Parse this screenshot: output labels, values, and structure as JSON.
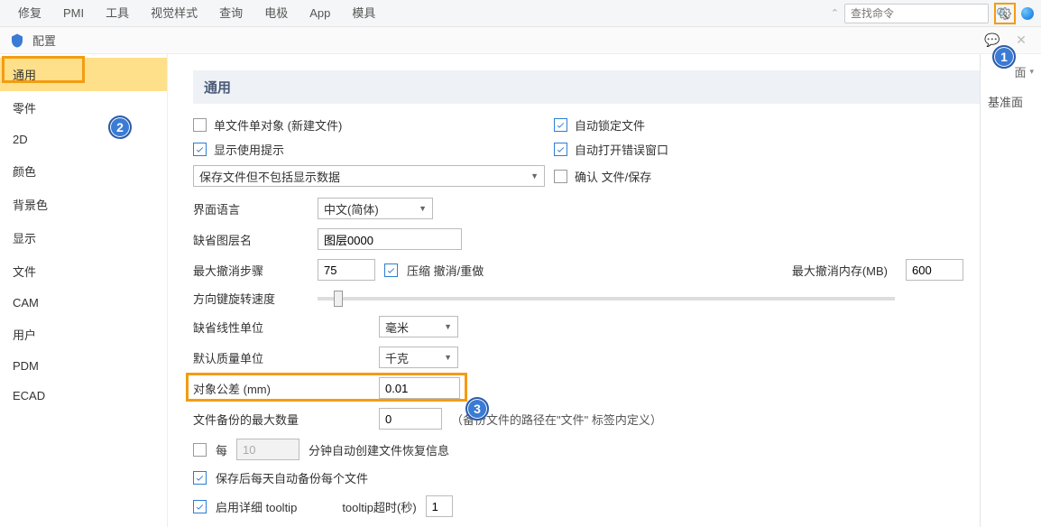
{
  "callouts": {
    "c1": "1",
    "c2": "2",
    "c3": "3"
  },
  "menubar": {
    "items": [
      "修复",
      "PMI",
      "工具",
      "视觉样式",
      "查询",
      "电极",
      "App",
      "模具"
    ],
    "search_placeholder": "查找命令"
  },
  "config": {
    "title": "配置",
    "nav": [
      "通用",
      "零件",
      "2D",
      "颜色",
      "背景色",
      "显示",
      "文件",
      "CAM",
      "用户",
      "PDM",
      "ECAD"
    ],
    "section_title": "通用",
    "checkboxes": {
      "single_file_obj": {
        "label": "单文件单对象 (新建文件)",
        "checked": false
      },
      "auto_lock": {
        "label": "自动锁定文件",
        "checked": true
      },
      "show_hints": {
        "label": "显示使用提示",
        "checked": true
      },
      "auto_open_err": {
        "label": "自动打开错误窗口",
        "checked": true
      },
      "confirm_save": {
        "label": "确认 文件/保存",
        "checked": false
      },
      "compress_undo": {
        "label": "压缩 撤消/重做",
        "checked": true
      },
      "every_min": {
        "label": "每",
        "checked": false
      },
      "save_backup_daily": {
        "label": "保存后每天自动备份每个文件",
        "checked": true
      },
      "enable_tooltip": {
        "label": "启用详细 tooltip",
        "checked": true
      }
    },
    "dropdowns": {
      "save_mode": "保存文件但不包括显示数据",
      "ui_lang": "中文(简体)",
      "linear_unit": "毫米",
      "mass_unit": "千克"
    },
    "labels": {
      "ui_lang": "界面语言",
      "default_layer": "缺省图层名",
      "max_undo": "最大撤消步骤",
      "max_undo_mem": "最大撤消内存(MB)",
      "arrow_rot_speed": "方向键旋转速度",
      "default_linear_unit": "缺省线性单位",
      "default_mass_unit": "默认质量单位",
      "obj_tol": "对象公差  (mm)",
      "max_backups": "文件备份的最大数量",
      "backup_note": "（备份文件的路径在\"文件\" 标签内定义）",
      "auto_recover_suffix": "分钟自动创建文件恢复信息",
      "tooltip_delay": "tooltip超时(秒)"
    },
    "values": {
      "default_layer": "图层0000",
      "max_undo": "75",
      "max_undo_mem": "600",
      "obj_tol": "0.01",
      "max_backups": "0",
      "every_min": "10",
      "tooltip_delay": "1"
    }
  },
  "right_pane": {
    "tab": "面",
    "label": "基准面"
  }
}
